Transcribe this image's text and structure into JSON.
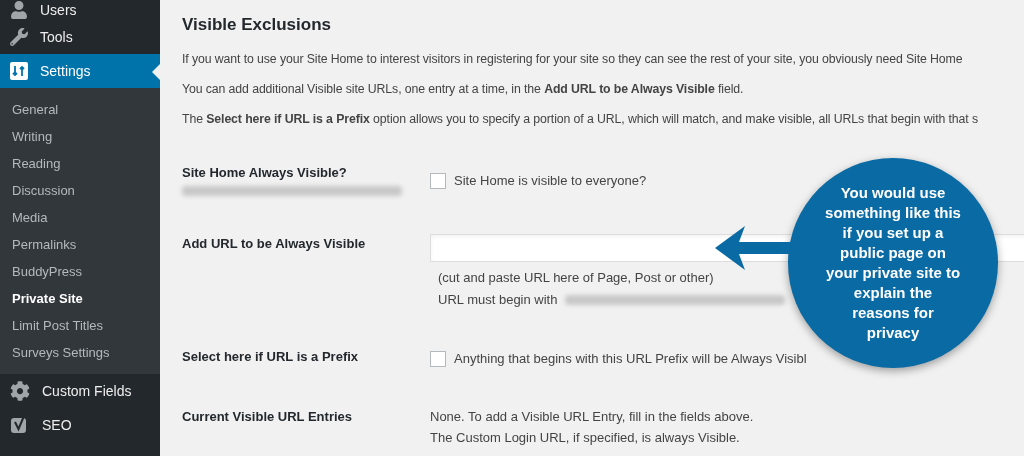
{
  "sidebar": {
    "items": [
      {
        "label": "Users",
        "selected": false
      },
      {
        "label": "Tools",
        "selected": false
      },
      {
        "label": "Settings",
        "selected": true,
        "children": [
          {
            "label": "General",
            "selected": false
          },
          {
            "label": "Writing",
            "selected": false
          },
          {
            "label": "Reading",
            "selected": false
          },
          {
            "label": "Discussion",
            "selected": false
          },
          {
            "label": "Media",
            "selected": false
          },
          {
            "label": "Permalinks",
            "selected": false
          },
          {
            "label": "BuddyPress",
            "selected": false
          },
          {
            "label": "Private Site",
            "selected": true
          },
          {
            "label": "Limit Post Titles",
            "selected": false
          },
          {
            "label": "Surveys Settings",
            "selected": false
          }
        ]
      },
      {
        "label": "Custom Fields",
        "selected": false
      },
      {
        "label": "SEO",
        "selected": false
      }
    ]
  },
  "section": {
    "title": "Visible Exclusions",
    "paragraphs": [
      "If you want to use your Site Home to interest visitors in registering for your site so they can see the rest of your site, you obviously need Site Home",
      "You can add additional Visible site URLs, one entry at a time, in the **Add URL to be Always Visible** field.",
      "The **Select here if URL is a Prefix** option allows you to specify a portion of a URL, which will match, and make visible, all URLs that begin with that s"
    ],
    "rows": [
      {
        "label": "Site Home Always Visible?",
        "label_redacted": true,
        "kind": "checkbox",
        "checked": false,
        "text": "Site Home is visible to everyone?"
      },
      {
        "label": "Add URL to be Always Visible",
        "label_redacted": false,
        "kind": "text",
        "hints": [
          {
            "text": "(cut and paste URL here of Page, Post or other)",
            "redacted": false
          },
          {
            "text": "URL must begin with",
            "redacted": true
          }
        ]
      },
      {
        "label": "Select here if URL is a Prefix",
        "label_redacted": false,
        "kind": "checkbox",
        "checked": false,
        "text": "Anything that begins with this URL Prefix will be Always Visibl"
      },
      {
        "label": "Current Visible URL Entries",
        "label_redacted": false,
        "kind": "note",
        "lines": [
          "None. To add a Visible URL Entry, fill in the fields above.",
          "The Custom Login URL, if specified, is always Visible."
        ]
      }
    ]
  },
  "callout": {
    "text": "You would use something like this if you set up a public page on your private site to explain the reasons for privacy"
  }
}
